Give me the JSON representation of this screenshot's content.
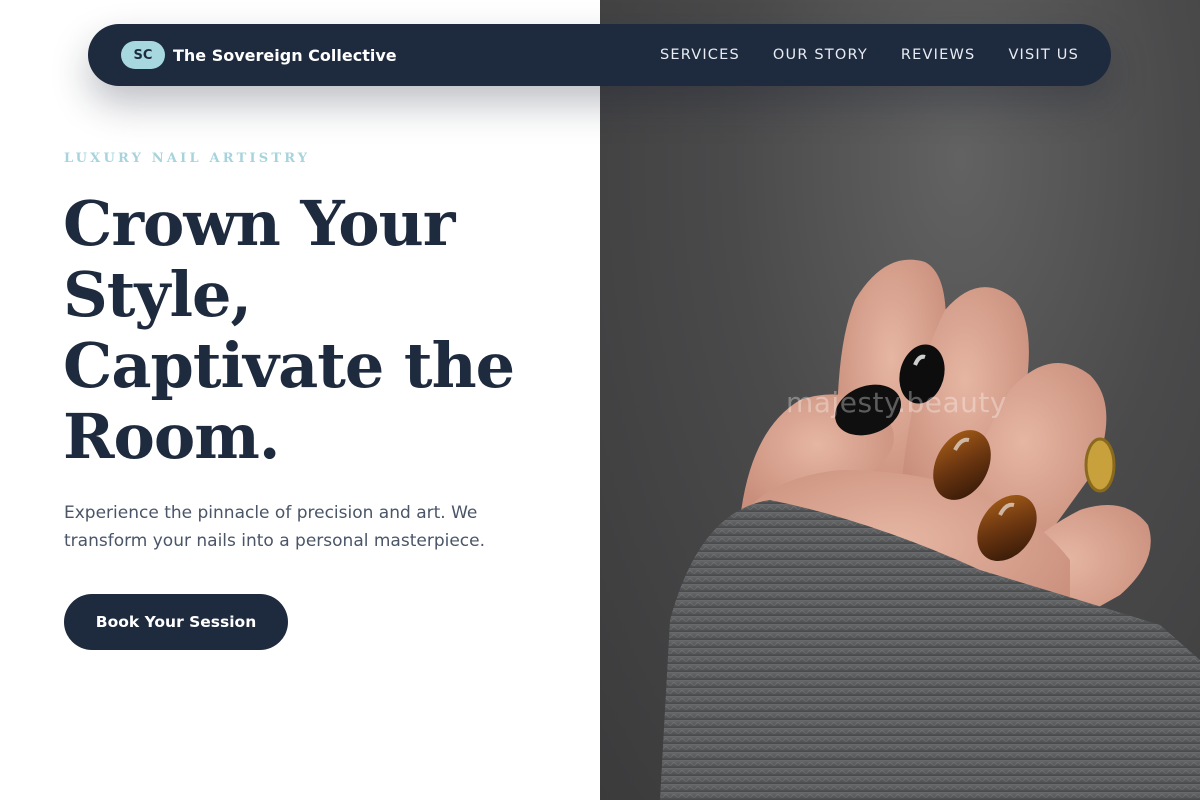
{
  "brand": {
    "initials": "SC",
    "name": "The Sovereign Collective"
  },
  "nav": {
    "links": [
      "SERVICES",
      "OUR STORY",
      "REVIEWS",
      "VISIT US"
    ]
  },
  "hero": {
    "eyebrow": "LUXURY NAIL ARTISTRY",
    "headline_lines": [
      "Crown Your",
      "Style,",
      "Captivate the",
      "Room."
    ],
    "lead": "Experience the pinnacle of precision and art. We transform your nails into a personal masterpiece.",
    "cta_label": "Book Your Session"
  },
  "photo": {
    "watermark": "majesty.beauty"
  },
  "colors": {
    "navy": "#1e2a3e",
    "accent": "#a8d8df",
    "body_text": "#4a5568"
  }
}
